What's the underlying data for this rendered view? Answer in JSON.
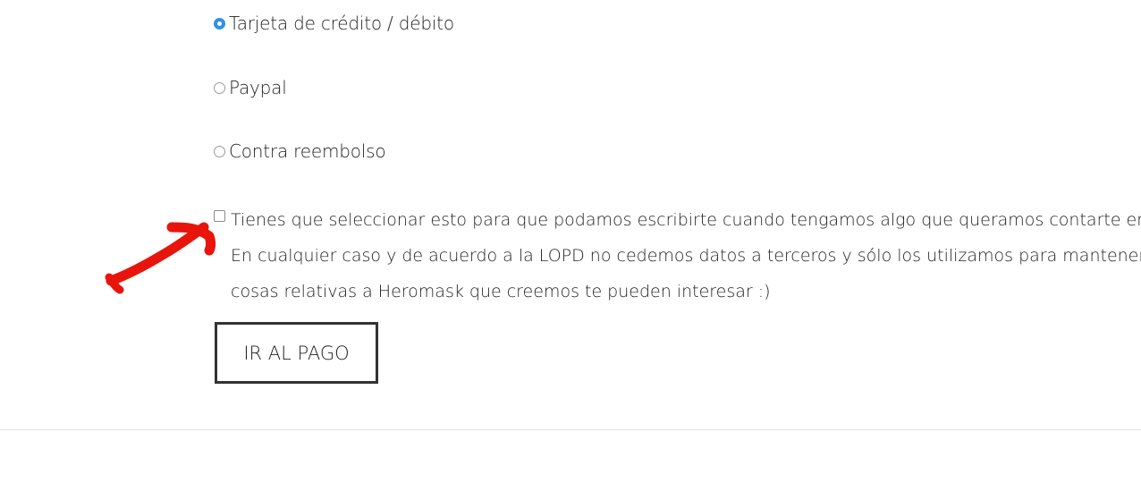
{
  "payment_options": [
    {
      "label": "Tarjeta de crédito / débito",
      "checked": true
    },
    {
      "label": "Paypal",
      "checked": false
    },
    {
      "label": "Contra reembolso",
      "checked": false
    }
  ],
  "consent": {
    "checked": false,
    "line1": "Tienes que seleccionar esto para que podamos escribirte cuando tengamos algo que queramos contarte en relación",
    "line2": "En cualquier caso y de acuerdo a la LOPD no cedemos datos a terceros y sólo los utilizamos para manteneros informados",
    "line3": "cosas relativas a Heromask que creemos te pueden interesar :)"
  },
  "submit_button": {
    "label": "IR AL PAGO"
  },
  "colors": {
    "radio_selected": "#2f8ff0",
    "annotation": "#e8150c"
  }
}
